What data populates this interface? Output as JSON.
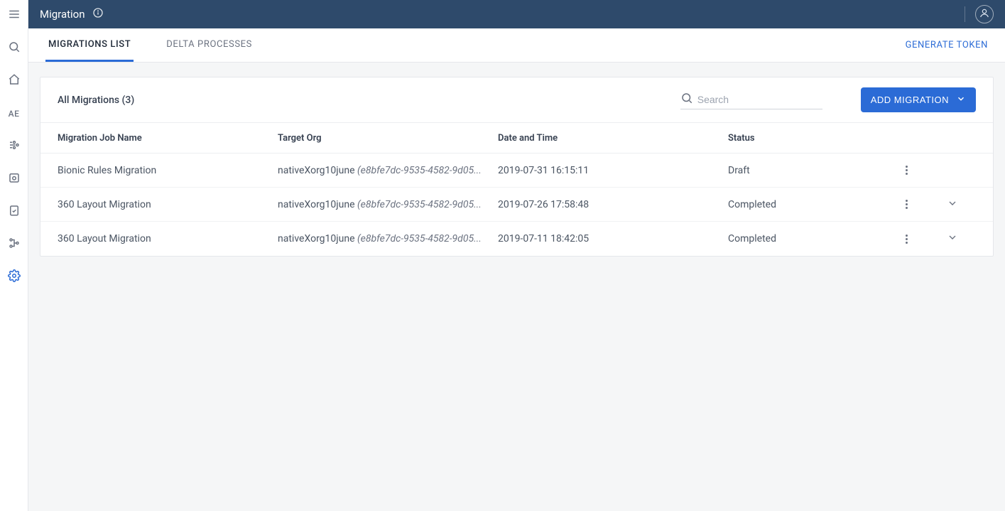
{
  "header": {
    "title": "Migration"
  },
  "sidebar": {
    "ae_label": "AE"
  },
  "tabs": {
    "list": "MIGRATIONS LIST",
    "delta": "DELTA PROCESSES",
    "generate": "GENERATE TOKEN"
  },
  "panel": {
    "title": "All Migrations (3)",
    "search_placeholder": "Search",
    "add_label": "ADD MIGRATION"
  },
  "columns": {
    "name": "Migration Job Name",
    "target": "Target Org",
    "date": "Date and Time",
    "status": "Status"
  },
  "rows": [
    {
      "name": "Bionic Rules Migration",
      "org_name": "nativeXorg10june",
      "org_id": "(e8bfe7dc-9535-4582-9d05...",
      "date": "2019-07-31 16:15:11",
      "status": "Draft",
      "expandable": false
    },
    {
      "name": "360 Layout Migration",
      "org_name": "nativeXorg10june",
      "org_id": "(e8bfe7dc-9535-4582-9d05...",
      "date": "2019-07-26 17:58:48",
      "status": "Completed",
      "expandable": true
    },
    {
      "name": "360 Layout Migration",
      "org_name": "nativeXorg10june",
      "org_id": "(e8bfe7dc-9535-4582-9d05...",
      "date": "2019-07-11 18:42:05",
      "status": "Completed",
      "expandable": true
    }
  ]
}
